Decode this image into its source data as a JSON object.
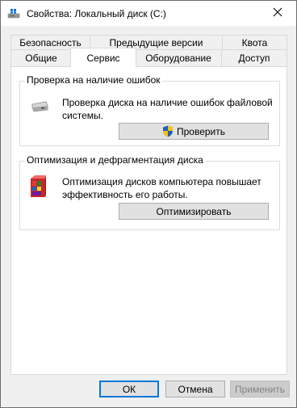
{
  "window": {
    "title": "Свойства: Локальный диск (C:)"
  },
  "tabs_back": [
    {
      "id": "security",
      "label": "Безопасность"
    },
    {
      "id": "previous-versions",
      "label": "Предыдущие версии"
    },
    {
      "id": "quota",
      "label": "Квота"
    }
  ],
  "tabs_front": [
    {
      "id": "general",
      "label": "Общие"
    },
    {
      "id": "tools",
      "label": "Сервис"
    },
    {
      "id": "hardware",
      "label": "Оборудование"
    },
    {
      "id": "sharing",
      "label": "Доступ"
    }
  ],
  "active_tab": "Сервис",
  "error_checking": {
    "title": "Проверка на наличие ошибок",
    "description_line1": "Проверка диска на наличие ошибок файловой",
    "description_line2": "системы.",
    "button_label": "Проверить",
    "icon": "drive-icon"
  },
  "optimize": {
    "title": "Оптимизация и дефрагментация диска",
    "description_line1": "Оптимизация дисков компьютера повышает",
    "description_line2": "эффективность его работы.",
    "button_label": "Оптимизировать",
    "icon": "defrag-icon"
  },
  "footer": {
    "ok_label": "ОК",
    "cancel_label": "Отмена",
    "apply_label": "Применить"
  },
  "colors": {
    "accent": "#0078d7",
    "window_bg": "#f0f0f0",
    "panel_bg": "#ffffff"
  }
}
